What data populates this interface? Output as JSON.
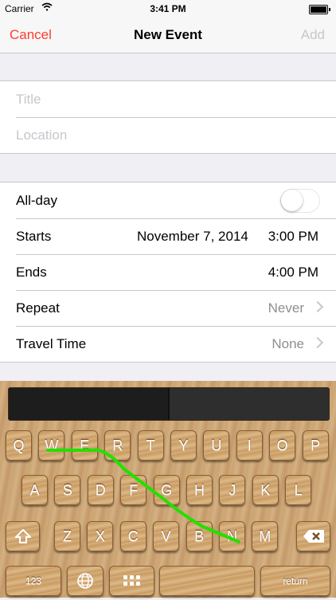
{
  "status": {
    "carrier": "Carrier",
    "time": "3:41 PM",
    "battery_level": 1.0
  },
  "nav": {
    "cancel": "Cancel",
    "title": "New Event",
    "add": "Add"
  },
  "form": {
    "title_placeholder": "Title",
    "location_placeholder": "Location",
    "allday_label": "All-day",
    "allday_on": false,
    "starts_label": "Starts",
    "starts_date": "November 7, 2014",
    "starts_time": "3:00 PM",
    "ends_label": "Ends",
    "ends_time": "4:00 PM",
    "repeat_label": "Repeat",
    "repeat_value": "Never",
    "travel_label": "Travel Time",
    "travel_value": "None"
  },
  "keyboard": {
    "row1": [
      "Q",
      "W",
      "E",
      "R",
      "T",
      "Y",
      "U",
      "I",
      "O",
      "P"
    ],
    "row2": [
      "A",
      "S",
      "D",
      "F",
      "G",
      "H",
      "J",
      "K",
      "L"
    ],
    "row3": [
      "Z",
      "X",
      "C",
      "V",
      "B",
      "N",
      "M"
    ],
    "numbers": "123",
    "return": "return",
    "icons": [
      "shift-icon",
      "delete-icon",
      "globe-icon",
      "keypad-icon"
    ],
    "swipe_color": "#22e000"
  },
  "colors": {
    "accent": "#ff3b30",
    "disabled": "#c7c7cc"
  }
}
